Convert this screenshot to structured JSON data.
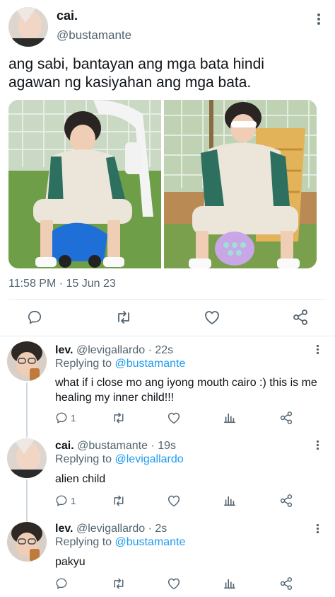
{
  "main_tweet": {
    "display_name": "cai.",
    "handle": "@bustamante",
    "text": "ang sabi, bantayan ang mga bata hindi agawan ng kasiyahan ang mga bata.",
    "timestamp": "11:58 PM · 15 Jun 23",
    "actions": [
      "reply-icon",
      "retweet-icon",
      "like-icon",
      "share-icon"
    ]
  },
  "replies": [
    {
      "display_name": "lev.",
      "handle": "@levigallardo",
      "age": "22s",
      "replying_label": "Replying to",
      "replying_to": "@bustamante",
      "text": "what if i close mo ang iyong mouth cairo :) this is me healing my inner child!!!",
      "reply_count": "1"
    },
    {
      "display_name": "cai.",
      "handle": "@bustamante",
      "age": "19s",
      "replying_label": "Replying to",
      "replying_to": "@levigallardo",
      "text": "alien child",
      "reply_count": "1"
    },
    {
      "display_name": "lev.",
      "handle": "@levigallardo",
      "age": "2s",
      "replying_label": "Replying to",
      "replying_to": "@bustamante",
      "text": "pakyu",
      "reply_count": ""
    }
  ],
  "colors": {
    "accent": "#1d9bf0",
    "secondary_text": "#536471",
    "divider": "#e6ecf0"
  }
}
